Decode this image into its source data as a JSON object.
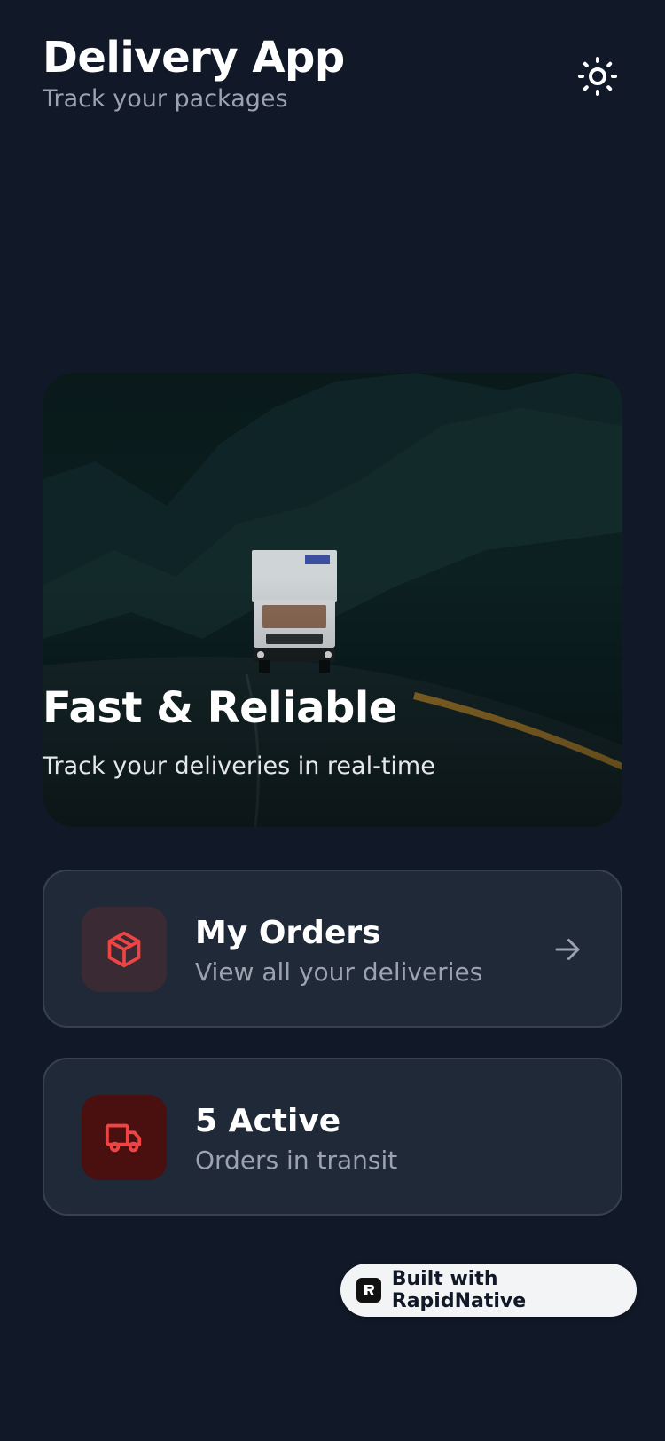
{
  "header": {
    "title": "Delivery App",
    "subtitle": "Track your packages",
    "theme_icon": "sun-icon"
  },
  "hero": {
    "title": "Fast & Reliable",
    "subtitle": "Track your deliveries in real-time",
    "image": "truck-on-road-photo"
  },
  "cards": [
    {
      "title": "My Orders",
      "subtitle": "View all your deliveries",
      "icon": "package-icon",
      "icon_color": "#ef4444",
      "icon_bg": "#3a2a33",
      "action_icon": "arrow-right-icon"
    },
    {
      "title": "5 Active",
      "subtitle": "Orders in transit",
      "icon": "truck-icon",
      "icon_color": "#ef4444",
      "icon_bg": "#4a0f0f"
    }
  ],
  "badge": {
    "label": "Built with RapidNative",
    "icon": "rapidnative-logo-icon"
  },
  "colors": {
    "background": "#111827",
    "card": "#1f2937",
    "accent": "#ef4444",
    "muted_text": "#9ca3af"
  }
}
